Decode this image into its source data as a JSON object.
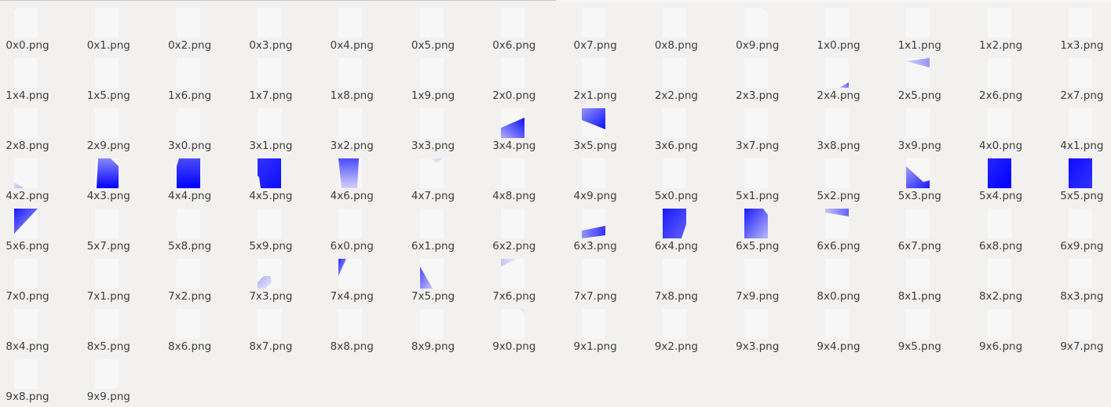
{
  "file_view": {
    "files": [
      {
        "name": "0x0.png"
      },
      {
        "name": "0x1.png"
      },
      {
        "name": "0x2.png"
      },
      {
        "name": "0x3.png"
      },
      {
        "name": "0x4.png"
      },
      {
        "name": "0x5.png"
      },
      {
        "name": "0x6.png"
      },
      {
        "name": "0x7.png"
      },
      {
        "name": "0x8.png"
      },
      {
        "name": "0x9.png"
      },
      {
        "name": "1x0.png"
      },
      {
        "name": "1x1.png"
      },
      {
        "name": "1x2.png"
      },
      {
        "name": "1x3.png"
      },
      {
        "name": "1x4.png"
      },
      {
        "name": "1x5.png"
      },
      {
        "name": "1x6.png"
      },
      {
        "name": "1x7.png"
      },
      {
        "name": "1x8.png"
      },
      {
        "name": "1x9.png"
      },
      {
        "name": "2x0.png"
      },
      {
        "name": "2x1.png"
      },
      {
        "name": "2x2.png"
      },
      {
        "name": "2x3.png"
      },
      {
        "name": "2x4.png"
      },
      {
        "name": "2x5.png"
      },
      {
        "name": "2x6.png"
      },
      {
        "name": "2x7.png"
      },
      {
        "name": "2x8.png"
      },
      {
        "name": "2x9.png"
      },
      {
        "name": "3x0.png"
      },
      {
        "name": "3x1.png"
      },
      {
        "name": "3x2.png"
      },
      {
        "name": "3x3.png"
      },
      {
        "name": "3x4.png"
      },
      {
        "name": "3x5.png"
      },
      {
        "name": "3x6.png"
      },
      {
        "name": "3x7.png"
      },
      {
        "name": "3x8.png"
      },
      {
        "name": "3x9.png"
      },
      {
        "name": "4x0.png"
      },
      {
        "name": "4x1.png"
      },
      {
        "name": "4x2.png"
      },
      {
        "name": "4x3.png"
      },
      {
        "name": "4x4.png"
      },
      {
        "name": "4x5.png"
      },
      {
        "name": "4x6.png"
      },
      {
        "name": "4x7.png"
      },
      {
        "name": "4x8.png"
      },
      {
        "name": "4x9.png"
      },
      {
        "name": "5x0.png"
      },
      {
        "name": "5x1.png"
      },
      {
        "name": "5x2.png"
      },
      {
        "name": "5x3.png"
      },
      {
        "name": "5x4.png"
      },
      {
        "name": "5x5.png"
      },
      {
        "name": "5x6.png"
      },
      {
        "name": "5x7.png"
      },
      {
        "name": "5x8.png"
      },
      {
        "name": "5x9.png"
      },
      {
        "name": "6x0.png"
      },
      {
        "name": "6x1.png"
      },
      {
        "name": "6x2.png"
      },
      {
        "name": "6x3.png"
      },
      {
        "name": "6x4.png"
      },
      {
        "name": "6x5.png"
      },
      {
        "name": "6x6.png"
      },
      {
        "name": "6x7.png"
      },
      {
        "name": "6x8.png"
      },
      {
        "name": "6x9.png"
      },
      {
        "name": "7x0.png"
      },
      {
        "name": "7x1.png"
      },
      {
        "name": "7x2.png"
      },
      {
        "name": "7x3.png"
      },
      {
        "name": "7x4.png"
      },
      {
        "name": "7x5.png"
      },
      {
        "name": "7x6.png"
      },
      {
        "name": "7x7.png"
      },
      {
        "name": "7x8.png"
      },
      {
        "name": "7x9.png"
      },
      {
        "name": "8x0.png"
      },
      {
        "name": "8x1.png"
      },
      {
        "name": "8x2.png"
      },
      {
        "name": "8x3.png"
      },
      {
        "name": "8x4.png"
      },
      {
        "name": "8x5.png"
      },
      {
        "name": "8x6.png"
      },
      {
        "name": "8x7.png"
      },
      {
        "name": "8x8.png"
      },
      {
        "name": "8x9.png"
      },
      {
        "name": "9x0.png"
      },
      {
        "name": "9x1.png"
      },
      {
        "name": "9x2.png"
      },
      {
        "name": "9x3.png"
      },
      {
        "name": "9x4.png"
      },
      {
        "name": "9x5.png"
      },
      {
        "name": "9x6.png"
      },
      {
        "name": "9x7.png"
      },
      {
        "name": "9x8.png"
      },
      {
        "name": "9x9.png"
      }
    ]
  },
  "colors": {
    "background": "#f2f1f0",
    "thumbnail_bg": "#f7f7f7",
    "tile_blue": "#0000ff",
    "label_text": "#3c3c3c"
  }
}
